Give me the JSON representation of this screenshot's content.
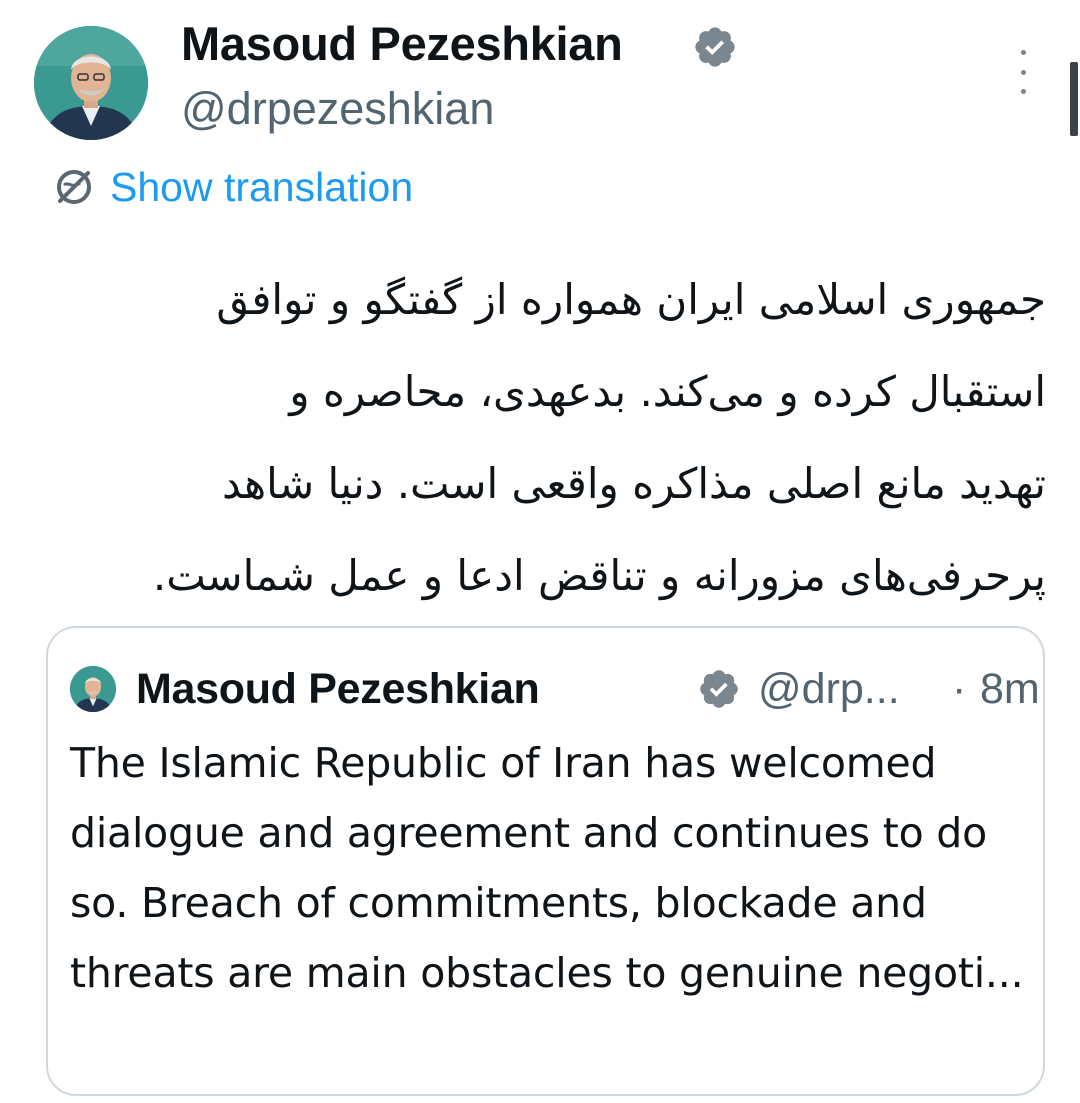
{
  "author": {
    "name": "Masoud Pezeshkian",
    "handle": "@drpezeshkian",
    "verified": true
  },
  "translate": {
    "label": "Show translation"
  },
  "tweet": {
    "text": "جمهوری اسلامی ایران همواره از گفتگو و توافق\nاستقبال کرده و می‌کند. بدعهدی، محاصره و\nتهدید مانع اصلی مذاکره واقعی است. دنیا شاهد\nپرحرفی‌های مزورانه و تناقض ادعا و عمل شماست."
  },
  "quote": {
    "name": "Masoud Pezeshkian",
    "handle": "@drp...",
    "separator": "·",
    "time": "8m",
    "text": "The Islamic Republic of Iran has welcomed dialogue and agreement and continues to do so. Breach of commitments, blockade and threats are main obstacles to genuine negoti..."
  },
  "colors": {
    "link": "#1d9bf0",
    "secondary_text": "#536471",
    "primary_text": "#0f1419",
    "card_border": "#cfd9de",
    "verified_badge": "#7b8790"
  },
  "icons": {
    "verified": "verified-badge-icon",
    "translate": "globe-translate-icon",
    "more": "more-options-icon"
  }
}
